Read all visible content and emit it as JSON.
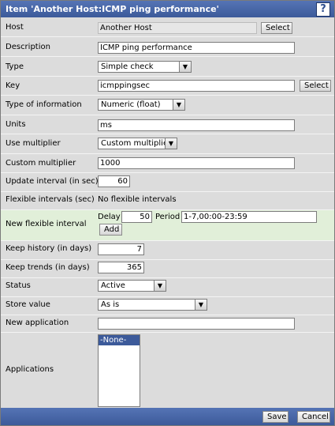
{
  "window": {
    "title": "Item 'Another Host:ICMP ping performance'",
    "help_icon": "?"
  },
  "form": {
    "host": {
      "label": "Host",
      "value": "Another Host",
      "button": "Select"
    },
    "description": {
      "label": "Description",
      "value": "ICMP ping performance"
    },
    "type": {
      "label": "Type",
      "selected": "Simple check"
    },
    "key": {
      "label": "Key",
      "value": "icmppingsec",
      "button": "Select"
    },
    "type_of_information": {
      "label": "Type of information",
      "selected": "Numeric (float)"
    },
    "units": {
      "label": "Units",
      "value": "ms"
    },
    "use_multiplier": {
      "label": "Use multiplier",
      "selected": "Custom multiplier"
    },
    "custom_multiplier": {
      "label": "Custom multiplier",
      "value": "1000"
    },
    "update_interval": {
      "label": "Update interval (in sec)",
      "value": "60"
    },
    "flexible_intervals": {
      "label": "Flexible intervals (sec)",
      "value": "No flexible intervals"
    },
    "new_flexible_interval": {
      "label": "New flexible interval",
      "delay_label": "Delay",
      "delay_value": "50",
      "period_label": "Period",
      "period_value": "1-7,00:00-23:59",
      "add_button": "Add"
    },
    "keep_history": {
      "label": "Keep history (in days)",
      "value": "7"
    },
    "keep_trends": {
      "label": "Keep trends (in days)",
      "value": "365"
    },
    "status": {
      "label": "Status",
      "selected": "Active"
    },
    "store_value": {
      "label": "Store value",
      "selected": "As is"
    },
    "new_application": {
      "label": "New application",
      "value": ""
    },
    "applications": {
      "label": "Applications",
      "options": [
        "-None-"
      ]
    }
  },
  "footer": {
    "save": "Save",
    "cancel": "Cancel"
  },
  "colors": {
    "header": "#3c5a9a",
    "row_bg": "#dcdcdc",
    "highlight_row": "#e1efd9"
  }
}
